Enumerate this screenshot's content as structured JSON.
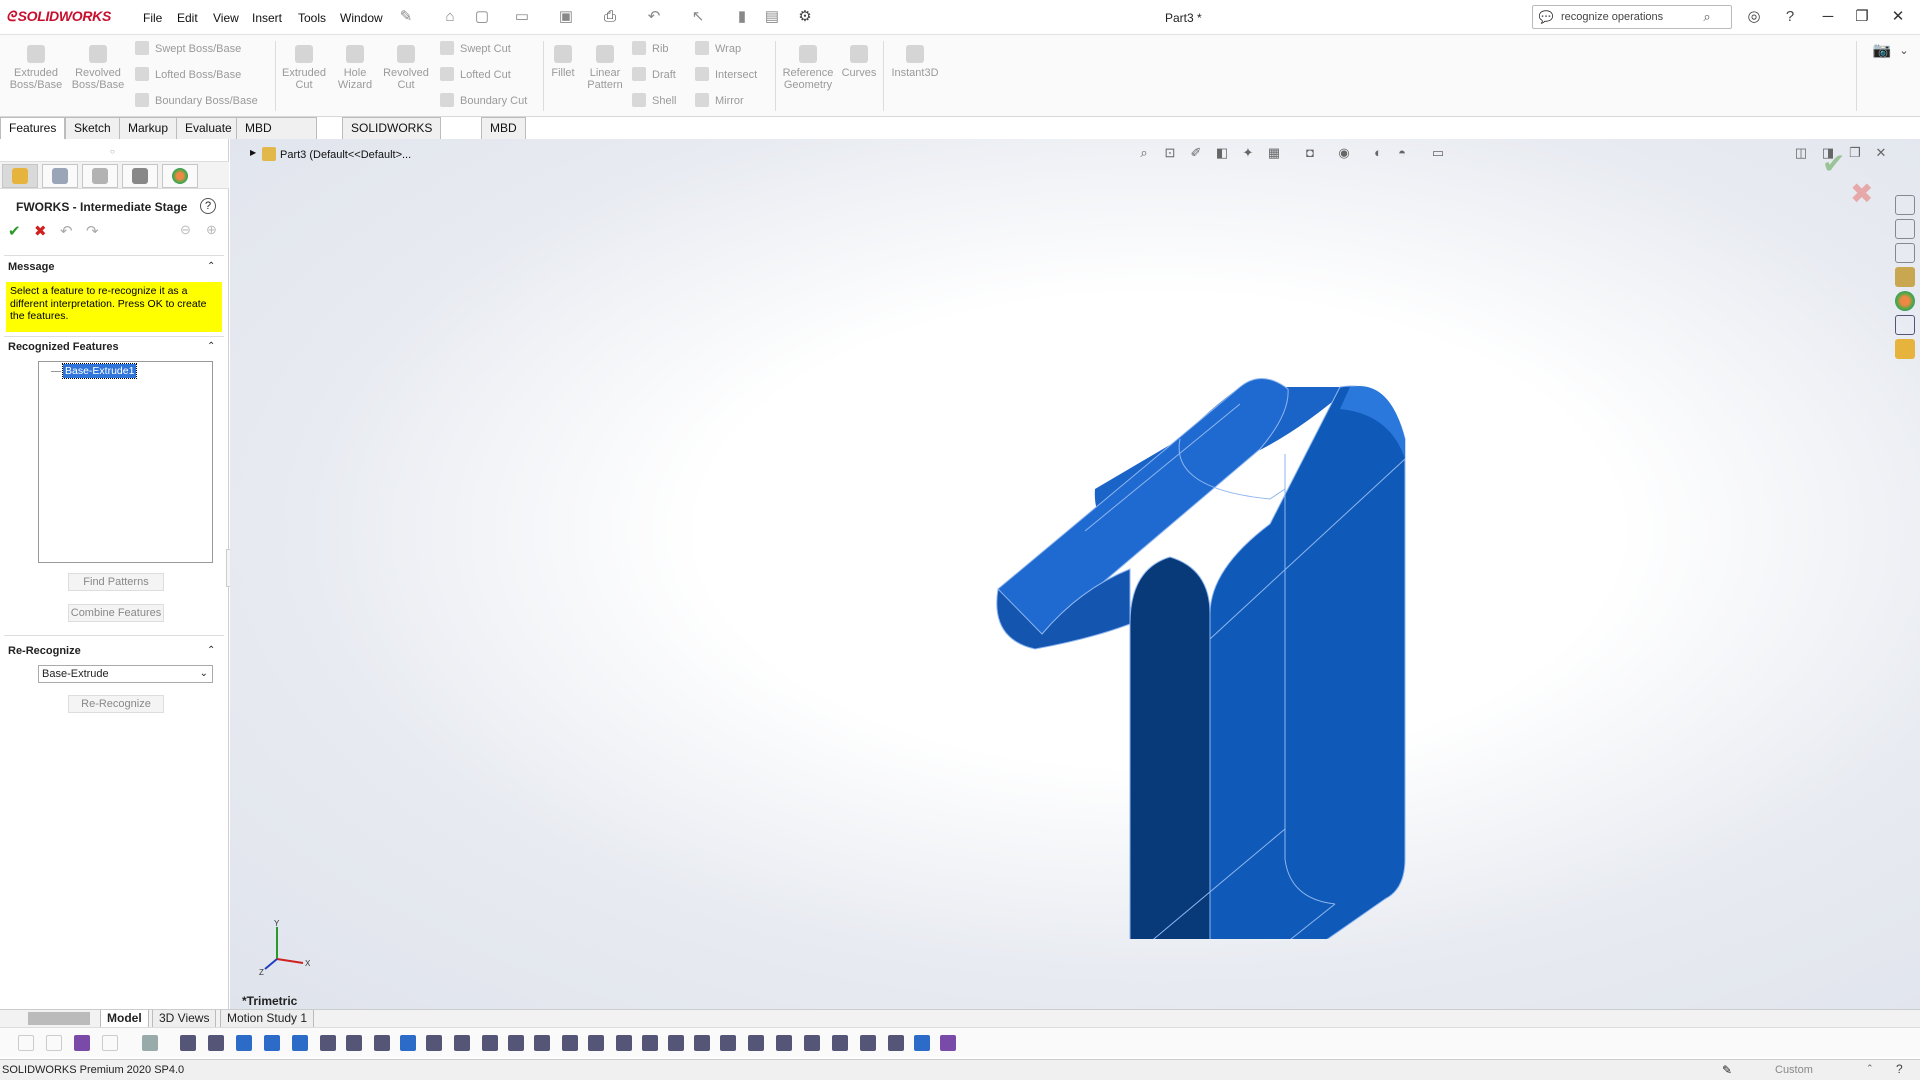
{
  "app": {
    "logo": "SOLIDWORKS",
    "doc_title": "Part3 *"
  },
  "menu": [
    "File",
    "Edit",
    "View",
    "Insert",
    "Tools",
    "Window"
  ],
  "search": {
    "value": "recognize operations"
  },
  "command_manager": {
    "big": [
      {
        "label": "Extruded\nBoss/Base"
      },
      {
        "label": "Revolved\nBoss/Base"
      },
      {
        "label": "Extruded\nCut"
      },
      {
        "label": "Hole\nWizard"
      },
      {
        "label": "Revolved\nCut"
      },
      {
        "label": "Fillet"
      },
      {
        "label": "Linear\nPattern"
      },
      {
        "label": "Reference\nGeometry"
      },
      {
        "label": "Curves"
      },
      {
        "label": "Instant3D"
      }
    ],
    "small": [
      "Swept Boss/Base",
      "Lofted Boss/Base",
      "Boundary Boss/Base",
      "Swept Cut",
      "Lofted Cut",
      "Boundary Cut",
      "Rib",
      "Draft",
      "Shell",
      "Wrap",
      "Intersect",
      "Mirror"
    ]
  },
  "tabs": [
    "Features",
    "Sketch",
    "Markup",
    "Evaluate",
    "MBD Dimensions",
    "SOLIDWORKS Add-Ins",
    "MBD"
  ],
  "active_tab": "Features",
  "property_manager": {
    "title": "FWORKS - Intermediate Stage",
    "help": "?",
    "message_header": "Message",
    "message": "Select a feature to re-recognize it as a different interpretation. Press OK to create the features.",
    "recognized_header": "Recognized Features",
    "recognized_items": [
      "Base-Extrude1"
    ],
    "find_patterns": "Find Patterns",
    "combine_features": "Combine Features",
    "rerecognize_header": "Re-Recognize",
    "rerecognize_select": "Base-Extrude",
    "rerecognize_button": "Re-Recognize"
  },
  "tree": {
    "root": "Part3  (Default<<Default>..."
  },
  "viewport": {
    "view_orientation": "*Trimetric",
    "model_color": "#1a5fc0"
  },
  "bottom_tabs": [
    "Model",
    "3D Views",
    "Motion Study 1"
  ],
  "active_bottom_tab": "Model",
  "status": {
    "text": "SOLIDWORKS Premium 2020 SP4.0",
    "units": "Custom"
  },
  "colors": {
    "accent": "#c8102e",
    "highlight": "#ffff00",
    "selection": "#3075d9"
  }
}
